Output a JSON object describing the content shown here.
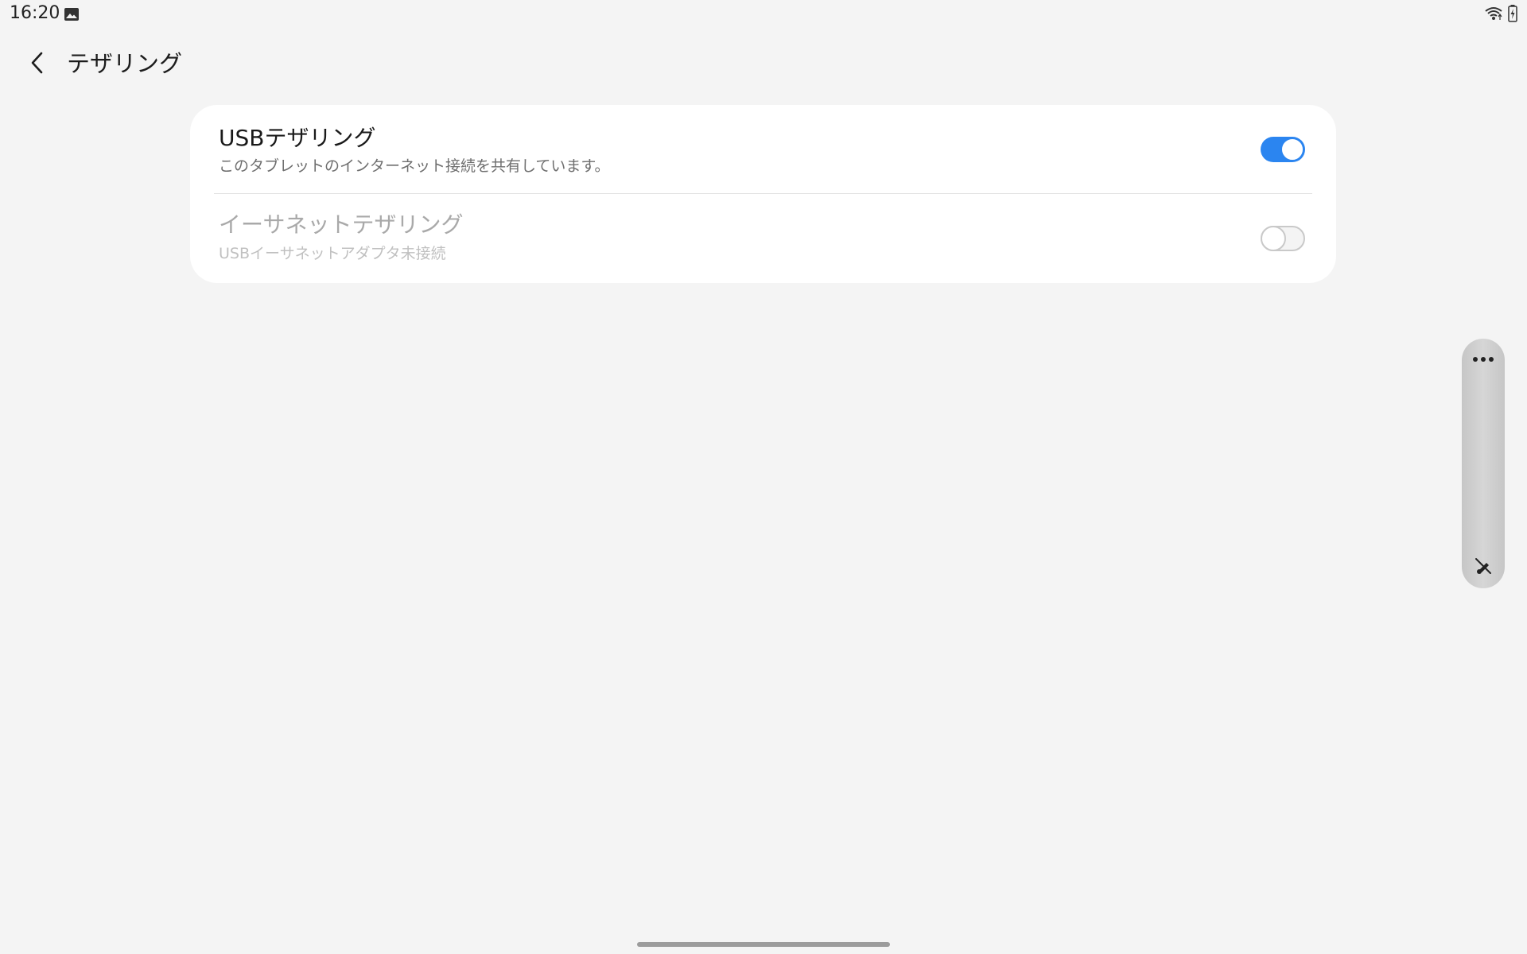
{
  "status_bar": {
    "time": "16:20",
    "left_icons": [
      "gallery-icon"
    ],
    "right_icons": [
      "wifi-icon",
      "battery-charging-icon"
    ]
  },
  "header": {
    "back_icon": "chevron-left-icon",
    "title": "テザリング"
  },
  "settings": [
    {
      "title": "USBテザリング",
      "summary": "このタブレットのインターネット接続を共有しています。",
      "enabled": true,
      "toggle_on": true
    },
    {
      "title": "イーサネットテザリング",
      "summary": "USBイーサネットアダプタ未接続",
      "enabled": false,
      "toggle_on": false
    }
  ],
  "edge_panel": {
    "top_icon": "more-horizontal-icon",
    "bottom_icon": "pen-off-icon"
  },
  "colors": {
    "background": "#f4f4f4",
    "card": "#ffffff",
    "accent": "#2b85f0",
    "disabled_text": "#a9a9a9"
  }
}
